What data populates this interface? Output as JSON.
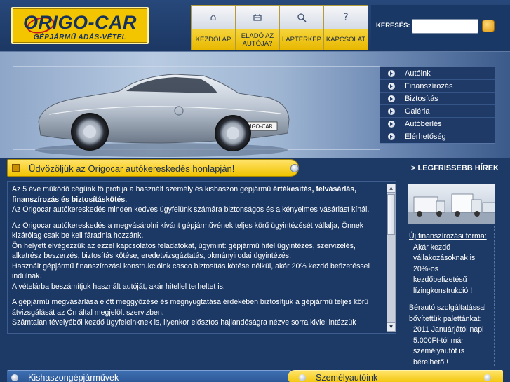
{
  "logo": {
    "name": "ORIGO-CAR",
    "tagline": "GÉPJÁRMŰ ADÁS-VÉTEL"
  },
  "nav": [
    {
      "label": "KEZDŐLAP",
      "icon": "home-icon",
      "glyph": "⌂"
    },
    {
      "label": "ELADÓ AZ AUTÓJA?",
      "icon": "car-sale-icon",
      "glyph": "🚗"
    },
    {
      "label": "LAPTÉRKÉP",
      "icon": "search-icon",
      "glyph": "⌕"
    },
    {
      "label": "KAPCSOLAT",
      "icon": "question-icon",
      "glyph": "?"
    }
  ],
  "search": {
    "label": "KERESÉS:",
    "value": "",
    "placeholder": ""
  },
  "hero": {
    "plate": "ORIGO-CAR"
  },
  "side_menu": [
    {
      "label": "Autóink"
    },
    {
      "label": "Finanszírozás"
    },
    {
      "label": "Biztosítás"
    },
    {
      "label": "Galéria"
    },
    {
      "label": "Autóbérlés"
    },
    {
      "label": "Elérhetőség"
    }
  ],
  "welcome": {
    "title": "Üdvözöljük az Origocar autókereskedés honlapján!"
  },
  "news": {
    "header": "> LEGFRISSEBB HÍREK",
    "items": [
      {
        "title": "Új finanszírozási forma:",
        "body": "Akár kezdő vállakozásoknak is 20%-os kezdőbefizetésű lízingkonstrukció !"
      },
      {
        "title": "Bérautó szolgáltatással bővítettük palettánkat:",
        "body": "2011 Januárjától napi 5.000Ft-tól már személyautót is bérelhető !"
      }
    ]
  },
  "main": {
    "p1_a": "Az 5 éve működő cégünk fő profilja a használt személy és kishaszon gépjármű ",
    "p1_b": "értékesítés, felvásárlás, finanszírozás és biztosításkötés",
    "p1_c": ".",
    "p1_d": "Az Origocar autókereskedés minden kedves ügyfelünk számára biztonságos és a kényelmes vásárlást kínál.",
    "p2_a": "Az Origocar autókereskedés a megvásárolni kívánt gépjárművének teljes körű ügyintézését vállalja, Önnek kizárólag csak be kell fáradnia hozzánk.",
    "p2_b": "Ön helyett elvégezzük az ezzel kapcsolatos feladatokat, úgymint: gépjármű hitel ügyintézés, szervizelés, alkatrész beszerzés, biztosítás kötése, eredetvizsgáztatás, okmányirodai ügyintézés.",
    "p2_c": "Használt gépjármű finanszírozási konstrukcióink casco biztosítás kötése nélkül, akár 20% kezdő befizetéssel indulnak.",
    "p2_d": "A vételárba beszámítjuk használt autóját, akár hitellel terheltet is.",
    "p3_a": "A gépjármű megvásárlása előtt meggyőzése és megnyugtatása érdekében biztosítjuk a gépjármű teljes körű átvizsgálását az Ön által megjelölt szervizben.",
    "p3_b": "Számtalan tévelyéből kezdő ügyfeleinknek is, ilyenkor elősztos hajlandóságra nézve sorra kiviel intézzük"
  },
  "bottom": {
    "left_label": "Kishaszongépjárművek",
    "right_label": "Személyautóink"
  },
  "colors": {
    "brand_yellow": "#f2c500",
    "navy": "#1d3a66",
    "accent_blue": "#2a5593"
  }
}
